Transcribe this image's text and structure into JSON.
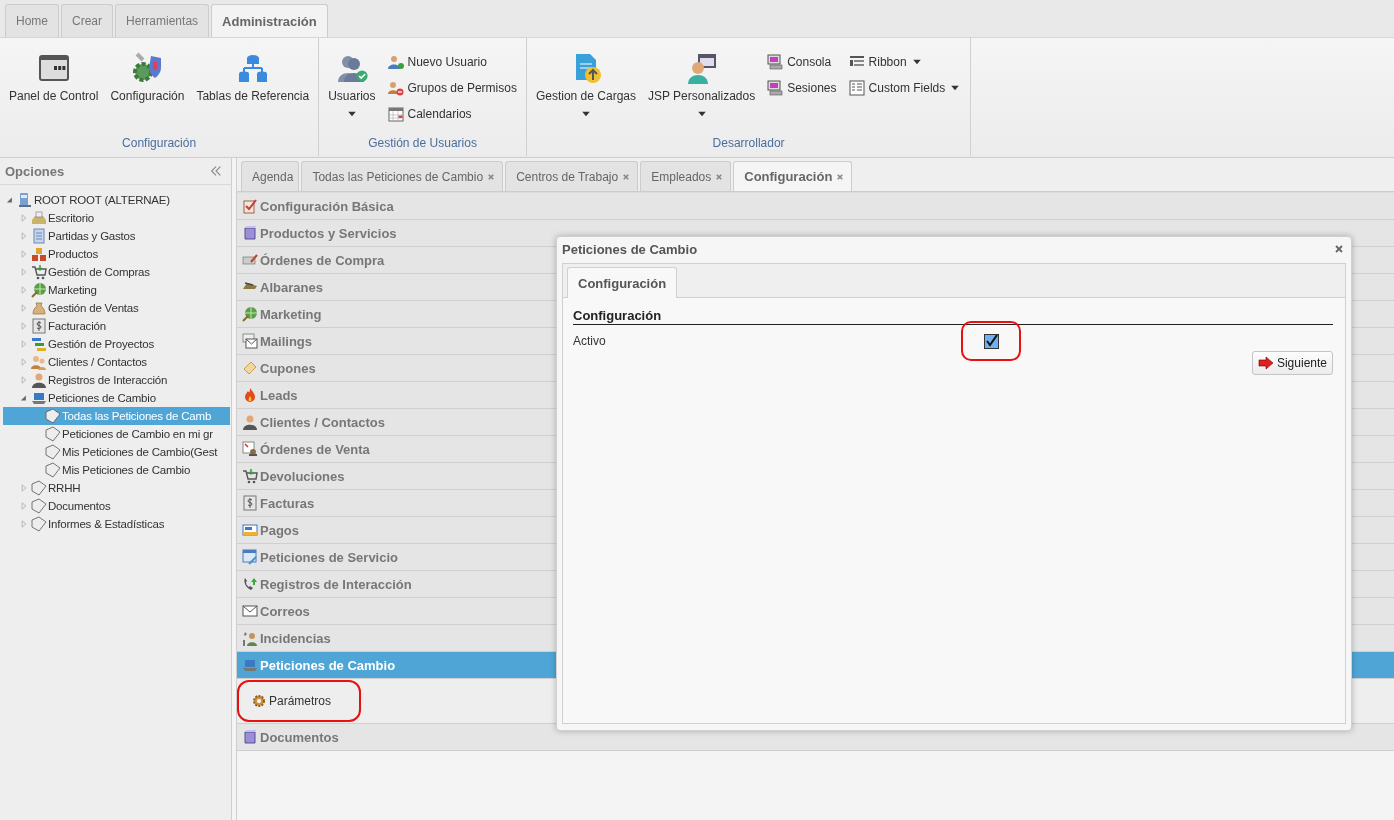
{
  "ribbon": {
    "tabs": [
      {
        "label": "Home",
        "selected": false
      },
      {
        "label": "Crear",
        "selected": false
      },
      {
        "label": "Herramientas",
        "selected": false
      },
      {
        "label": "Administración",
        "selected": true
      }
    ],
    "groups": [
      {
        "title": "Configuración",
        "items": [
          {
            "kind": "large",
            "label": "Panel de Control",
            "dropdown": false
          },
          {
            "kind": "large",
            "label": "Configuración",
            "dropdown": false
          },
          {
            "kind": "large",
            "label": "Tablas de Referencia",
            "dropdown": false
          }
        ]
      },
      {
        "title": "Gestión de Usuarios",
        "items": [
          {
            "kind": "large",
            "label": "Usuarios",
            "dropdown": true
          },
          {
            "kind": "stack",
            "items": [
              {
                "label": "Nuevo Usuario",
                "dropdown": false
              },
              {
                "label": "Grupos de Permisos",
                "dropdown": false
              },
              {
                "label": "Calendarios",
                "dropdown": false
              }
            ]
          }
        ]
      },
      {
        "title": "Desarrollador",
        "items": [
          {
            "kind": "large",
            "label": "Gestion de Cargas",
            "dropdown": true
          },
          {
            "kind": "large",
            "label": "JSP Personalizados",
            "dropdown": true
          },
          {
            "kind": "stack",
            "items": [
              {
                "label": "Consola",
                "dropdown": false
              },
              {
                "label": "Sesiones",
                "dropdown": false
              }
            ]
          },
          {
            "kind": "stack",
            "items": [
              {
                "label": "Ribbon",
                "dropdown": true
              },
              {
                "label": "Custom Fields",
                "dropdown": true
              }
            ]
          }
        ]
      }
    ]
  },
  "sidebar": {
    "title": "Opciones",
    "tree": [
      {
        "label": "ROOT ROOT (ALTERNAE)",
        "expanded": true,
        "selected": false,
        "children": [
          {
            "label": "Escritorio",
            "expanded": false,
            "selected": false
          },
          {
            "label": "Partidas y Gastos",
            "expanded": false,
            "selected": false
          },
          {
            "label": "Productos",
            "expanded": false,
            "selected": false
          },
          {
            "label": "Gestión de Compras",
            "expanded": false,
            "selected": false
          },
          {
            "label": "Marketing",
            "expanded": false,
            "selected": false
          },
          {
            "label": "Gestión de Ventas",
            "expanded": false,
            "selected": false
          },
          {
            "label": "Facturación",
            "expanded": false,
            "selected": false
          },
          {
            "label": "Gestión de Proyectos",
            "expanded": false,
            "selected": false
          },
          {
            "label": "Clientes / Contactos",
            "expanded": false,
            "selected": false
          },
          {
            "label": "Registros de Interacción",
            "expanded": false,
            "selected": false
          },
          {
            "label": "Peticiones de Cambio",
            "expanded": true,
            "selected": false,
            "children": [
              {
                "label": "Todas las Peticiones de Camb",
                "selected": true
              },
              {
                "label": "Peticiones de Cambio en mi gr",
                "selected": false
              },
              {
                "label": "Mis Peticiones de Cambio(Gest",
                "selected": false
              },
              {
                "label": "Mis Peticiones de Cambio",
                "selected": false
              }
            ]
          },
          {
            "label": "RRHH",
            "expanded": false,
            "selected": false
          },
          {
            "label": "Documentos",
            "expanded": false,
            "selected": false
          },
          {
            "label": "Informes & Estadísticas",
            "expanded": false,
            "selected": false
          }
        ]
      }
    ]
  },
  "tabs": [
    {
      "label": "Agenda",
      "closable": false,
      "selected": false
    },
    {
      "label": "Todas las Peticiones de Cambio",
      "closable": true,
      "selected": false
    },
    {
      "label": "Centros de Trabajo",
      "closable": true,
      "selected": false
    },
    {
      "label": "Empleados",
      "closable": true,
      "selected": false
    },
    {
      "label": "Configuración",
      "closable": true,
      "selected": true
    }
  ],
  "sections": [
    {
      "label": "Configuración Básica",
      "expanded": false
    },
    {
      "label": "Productos y Servicios",
      "expanded": false
    },
    {
      "label": "Órdenes de Compra",
      "expanded": false
    },
    {
      "label": "Albaranes",
      "expanded": false
    },
    {
      "label": "Marketing",
      "expanded": false
    },
    {
      "label": "Mailings",
      "expanded": false
    },
    {
      "label": "Cupones",
      "expanded": false
    },
    {
      "label": "Leads",
      "expanded": false
    },
    {
      "label": "Clientes / Contactos",
      "expanded": false
    },
    {
      "label": "Órdenes de Venta",
      "expanded": false
    },
    {
      "label": "Devoluciones",
      "expanded": false
    },
    {
      "label": "Facturas",
      "expanded": false
    },
    {
      "label": "Pagos",
      "expanded": false
    },
    {
      "label": "Peticiones de Servicio",
      "expanded": false
    },
    {
      "label": "Registros de Interacción",
      "expanded": false
    },
    {
      "label": "Correos",
      "expanded": false
    },
    {
      "label": "Incidencias",
      "expanded": false
    },
    {
      "label": "Peticiones de Cambio",
      "expanded": true,
      "children": [
        {
          "label": "Parámetros",
          "highlighted": true
        }
      ]
    },
    {
      "label": "Documentos",
      "expanded": false
    }
  ],
  "dialog": {
    "title": "Peticiones de Cambio",
    "tabs": [
      {
        "label": "Configuración",
        "selected": true
      }
    ],
    "section": "Configuración",
    "fields": [
      {
        "kind": "checkbox",
        "label": "Activo",
        "checked": true,
        "highlighted": true
      }
    ],
    "button": "Siguiente"
  }
}
